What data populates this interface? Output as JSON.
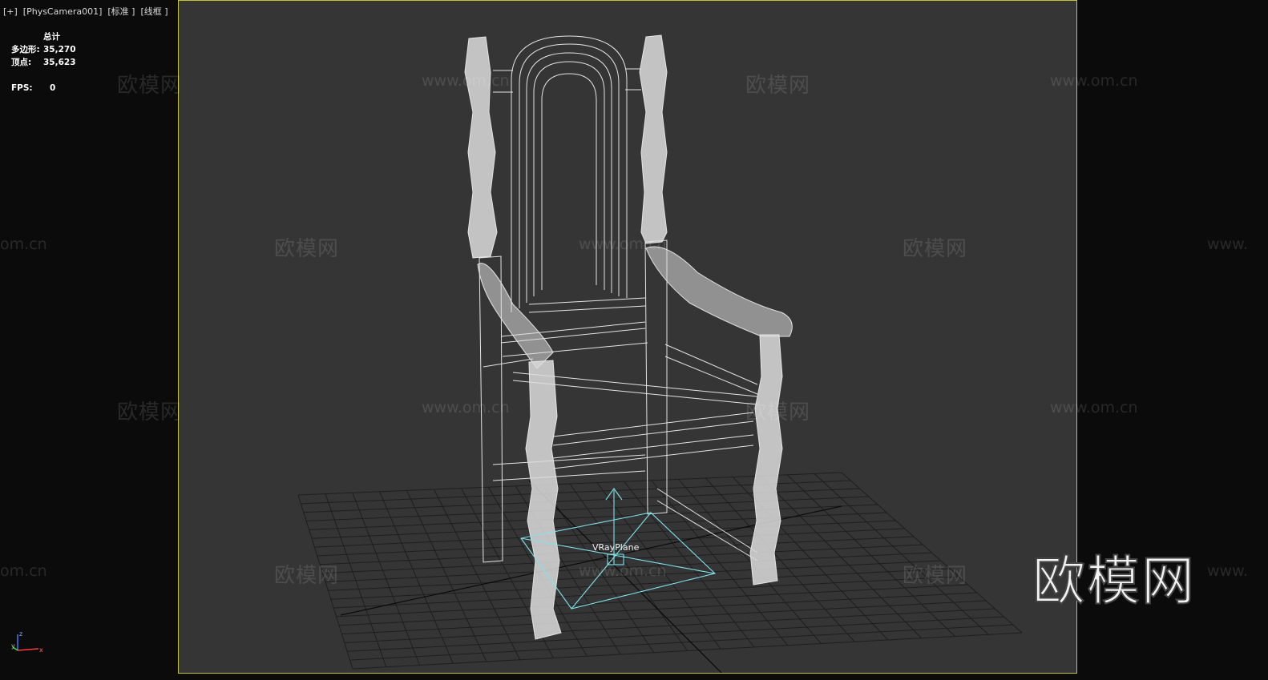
{
  "viewport": {
    "label": "[+]  [PhysCamera001]  [标准 ]  [线框 ]"
  },
  "stats": {
    "header": "总计",
    "polygons_label": "多边形:",
    "polygons_value": "35,270",
    "vertices_label": "顶点:",
    "vertices_value": "35,623",
    "fps_label": "FPS:",
    "fps_value": "0"
  },
  "watermarks": {
    "brand": "欧模网",
    "url": "www.om.cn",
    "url_fragment": "om.cn",
    "url_prefix": "www.",
    "big_logo": "欧模网"
  },
  "scene": {
    "object_label": "VRayPlane",
    "wire_color": "#e6e6e6",
    "plane_color": "#7fe3ea",
    "grid_color": "#1c1c1c",
    "viewport_bg": "#353535",
    "border_color": "#c9c22a"
  },
  "gizmo": {
    "x": "x",
    "y": "y",
    "z": "z"
  }
}
